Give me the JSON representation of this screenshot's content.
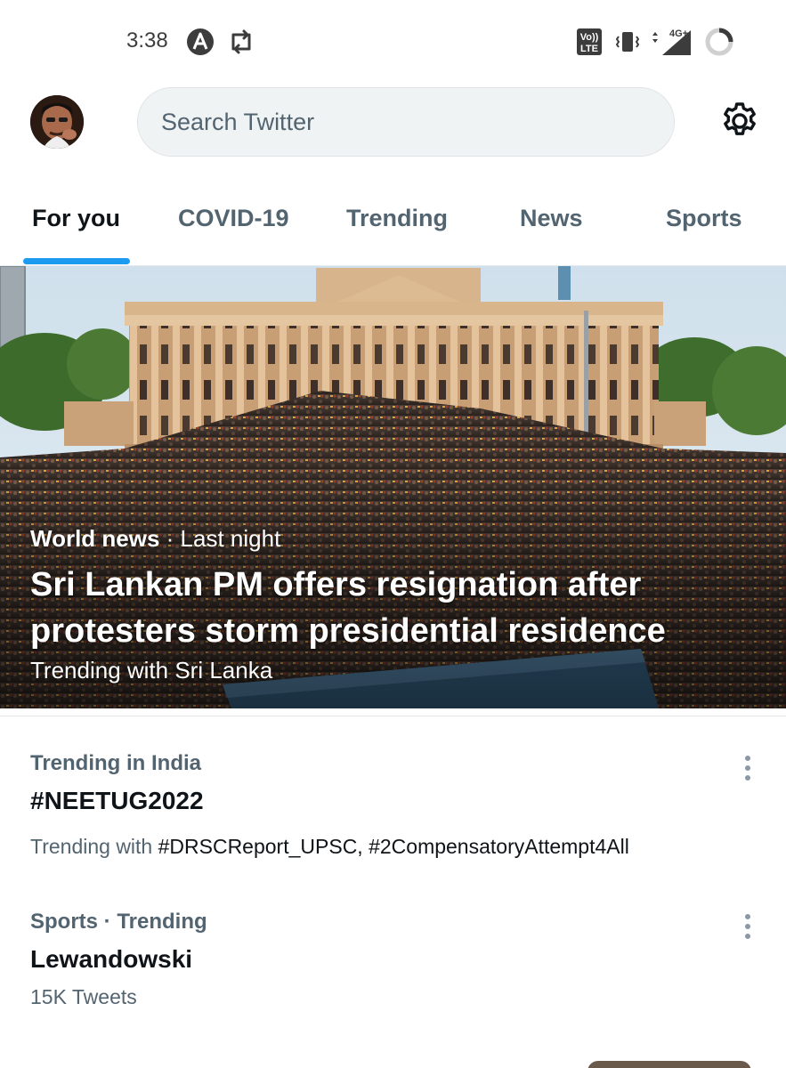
{
  "status_bar": {
    "time": "3:38",
    "icons": [
      "a-icon",
      "retweet-icon",
      "volte-icon",
      "vibrate-icon",
      "signal-4g-icon",
      "battery-icon"
    ],
    "volte_label_top": "Vo))",
    "volte_label_bottom": "LTE",
    "network_label": "4G+"
  },
  "header": {
    "search_placeholder": "Search Twitter",
    "settings_icon": "gear-icon",
    "avatar": "profile-avatar"
  },
  "tabs": [
    {
      "label": "For you",
      "active": true
    },
    {
      "label": "COVID-19",
      "active": false
    },
    {
      "label": "Trending",
      "active": false
    },
    {
      "label": "News",
      "active": false
    },
    {
      "label": "Sports",
      "active": false
    }
  ],
  "hero": {
    "category": "World news",
    "separator": " · ",
    "time": "Last night",
    "title": "Sri Lankan PM offers resignation after protesters storm presidential residence",
    "subtitle": "Trending with Sri Lanka"
  },
  "trends": [
    {
      "context": "Trending in India",
      "name": "#NEETUG2022",
      "meta_prefix": "Trending with ",
      "meta_tags": "#DRSCReport_UPSC, #2CompensatoryAttempt4All"
    },
    {
      "context": "Sports · Trending",
      "name": "Lewandowski",
      "meta_prefix": "15K Tweets",
      "meta_tags": ""
    }
  ],
  "colors": {
    "accent": "#1d9bf0",
    "text_primary": "#0f1419",
    "text_secondary": "#536471",
    "search_bg": "#eff3f4"
  }
}
